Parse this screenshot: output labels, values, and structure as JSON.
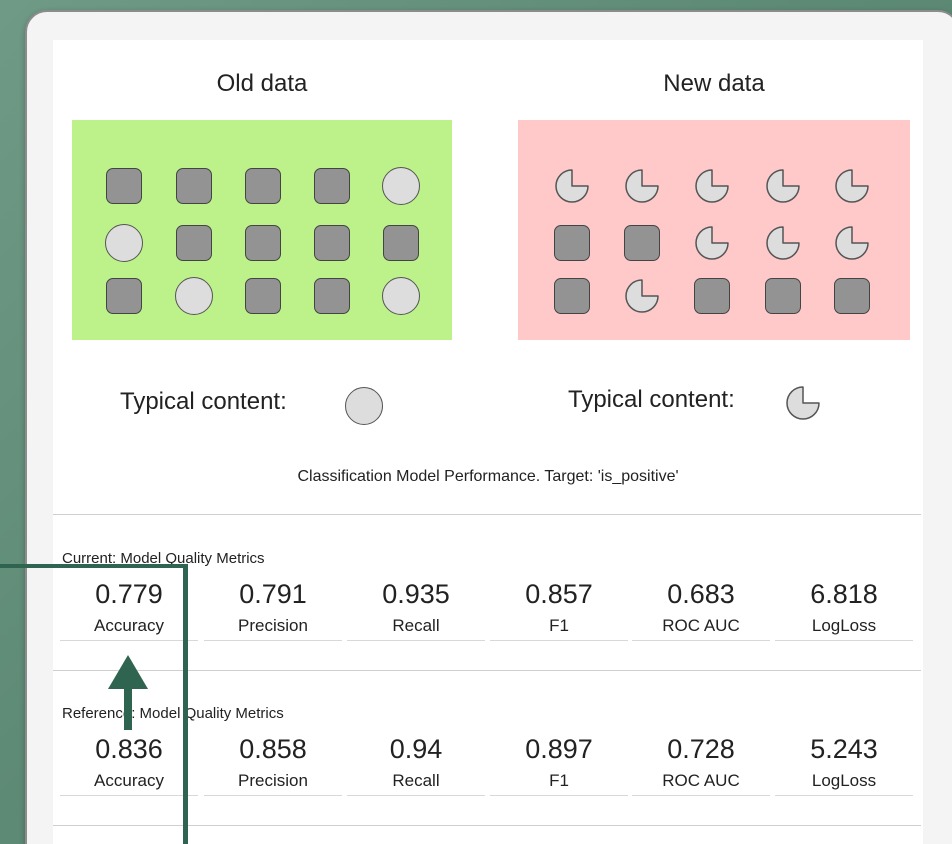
{
  "drift": {
    "old": {
      "title": "Old data",
      "typical_label": "Typical content:",
      "rows": [
        [
          "square",
          "square",
          "square",
          "square",
          "circle"
        ],
        [
          "circle",
          "square",
          "square",
          "square",
          "square"
        ],
        [
          "square",
          "circle",
          "square",
          "square",
          "circle"
        ]
      ]
    },
    "new": {
      "title": "New data",
      "typical_label": "Typical content:",
      "rows": [
        [
          "pac",
          "pac",
          "pac",
          "pac",
          "pac"
        ],
        [
          "square",
          "square",
          "pac",
          "pac",
          "pac"
        ],
        [
          "square",
          "pac",
          "square",
          "square",
          "square"
        ]
      ]
    },
    "colors": {
      "old_bg": "#bdf28a",
      "new_bg": "#ffc9c9",
      "shape_fill": "#939393",
      "annotation": "#2f6550"
    }
  },
  "report": {
    "subtitle": "Classification Model Performance. Target: 'is_positive'",
    "current": {
      "title": "Current: Model Quality Metrics",
      "metrics": [
        {
          "value": "0.779",
          "label": "Accuracy"
        },
        {
          "value": "0.791",
          "label": "Precision"
        },
        {
          "value": "0.935",
          "label": "Recall"
        },
        {
          "value": "0.857",
          "label": "F1"
        },
        {
          "value": "0.683",
          "label": "ROC AUC"
        },
        {
          "value": "6.818",
          "label": "LogLoss"
        }
      ]
    },
    "reference": {
      "title": "Reference: Model Quality Metrics",
      "metrics": [
        {
          "value": "0.836",
          "label": "Accuracy"
        },
        {
          "value": "0.858",
          "label": "Precision"
        },
        {
          "value": "0.94",
          "label": "Recall"
        },
        {
          "value": "0.897",
          "label": "F1"
        },
        {
          "value": "0.728",
          "label": "ROC AUC"
        },
        {
          "value": "5.243",
          "label": "LogLoss"
        }
      ]
    }
  }
}
